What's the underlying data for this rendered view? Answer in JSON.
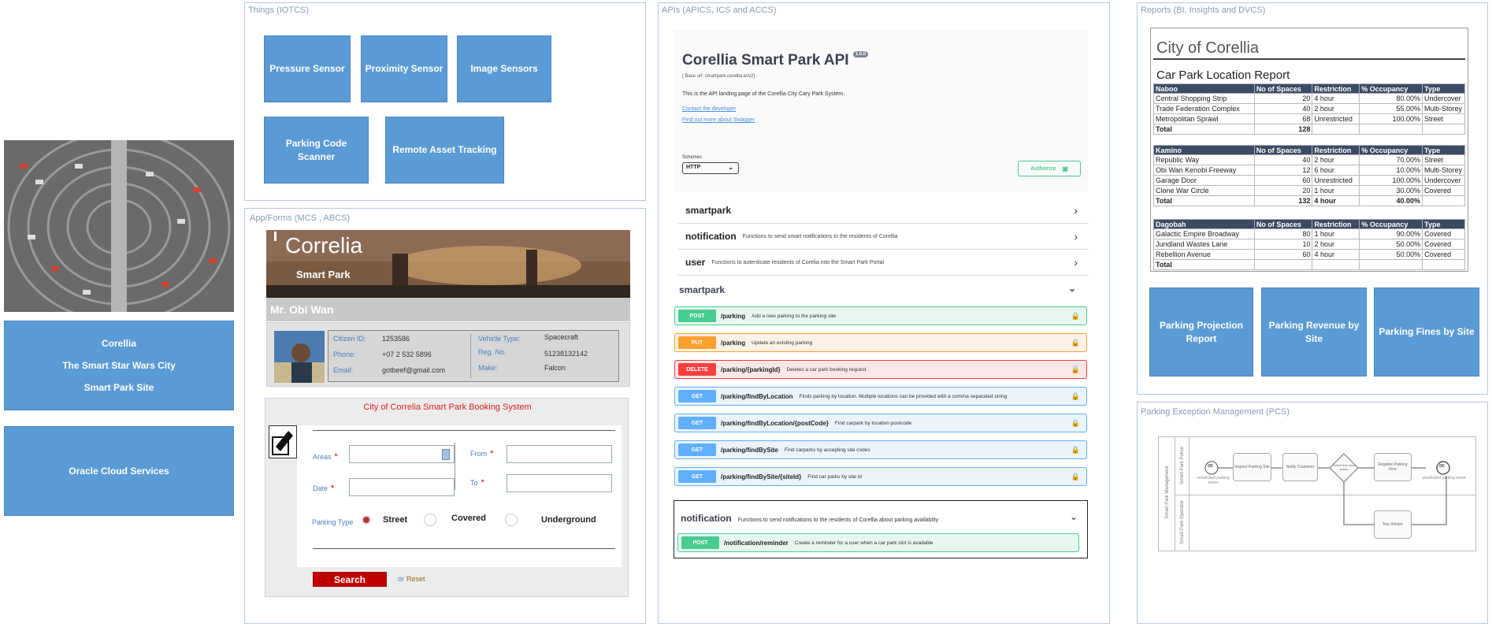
{
  "left": {
    "info_lines": [
      "Corellia",
      "The Smart Star Wars City",
      "Smart Park Site"
    ],
    "cloud_label": "Oracle Cloud Services"
  },
  "things": {
    "title": "Things (IOTCS)",
    "devices": [
      "Pressure Sensor",
      "Proximity Sensor",
      "Image Sensors",
      "Parking Code Scanner",
      "Remote Asset Tracking"
    ]
  },
  "app": {
    "title": "App/Forms (MCS , ABCS)",
    "banner_title": "Correlia",
    "banner_subtitle": "Smart Park",
    "user_name": "Mr. Obi Wan",
    "citizen": {
      "id_label": "Citizen ID:",
      "id_value": "1253586",
      "phone_label": "Phone:",
      "phone_value": "+07 2 532 5896",
      "email_label": "Email:",
      "email_value": "gotbeef@gmail.com",
      "vehicle_label": "Vehicle Type:",
      "vehicle_value": "Spacecraft",
      "reg_label": "Reg. No.",
      "reg_value": "51238132142",
      "make_label": "Make:",
      "make_value": "Falcon"
    },
    "booking": {
      "title": "City of Correlia Smart Park Booking System",
      "areas_label": "Areas",
      "date_label": "Date",
      "from_label": "From",
      "to_label": "To",
      "parking_type_label": "Parking Type",
      "options": [
        "Street",
        "Covered",
        "Underground"
      ],
      "search_label": "Search",
      "or_label": "or",
      "reset_label": "Reset"
    }
  },
  "apis": {
    "title": "APIs (APICS, ICS and ACCS)",
    "heading": "Corellia Smart Park API",
    "version_badge": "1.0.0",
    "base_url": "[ Base url: smartpark.corellia.io/v2]",
    "intro": "This is the API landing page of the Corellia City Cary Park System.",
    "link_contact": "Contact the developer",
    "link_swagger": "Find out more about Swagger",
    "schemes_label": "Schemes",
    "scheme_value": "HTTP",
    "authorize_label": "Authorize",
    "groups": [
      {
        "name": "smartpark",
        "desc": ""
      },
      {
        "name": "notification",
        "desc": "Functions to send smart notifications to the residents of Corellia"
      },
      {
        "name": "user",
        "desc": "Functions to autenticate residents of Corelia into the Smart Park Portal"
      }
    ],
    "section_name": "smartpark",
    "endpoints": [
      {
        "method": "POST",
        "path": "/parking",
        "desc": "Add a new parking to the parking site",
        "color": "#49cc90",
        "bg": "#e8f6f0"
      },
      {
        "method": "PUT",
        "path": "/parking",
        "desc": "Update an existing parking",
        "color": "#fca130",
        "bg": "#fbf1e6"
      },
      {
        "method": "DELETE",
        "path": "/parking/{parkingId}",
        "desc": "Deletes a car park booking request",
        "color": "#f93e3e",
        "bg": "#fae7e7"
      },
      {
        "method": "GET",
        "path": "/parking/findByLocation",
        "desc": "Finds parking by location. Multiple locations can be provided with a comma separated string",
        "color": "#61affe",
        "bg": "#ebf3fb"
      },
      {
        "method": "GET",
        "path": "/parking/findByLocation/{postCode}",
        "desc": "Find carpark by location postcode",
        "color": "#61affe",
        "bg": "#ebf3fb"
      },
      {
        "method": "GET",
        "path": "/parking/findBySite",
        "desc": "Find carparks by accepting site codes",
        "color": "#61affe",
        "bg": "#ebf3fb"
      },
      {
        "method": "GET",
        "path": "/parking/findBySite/{siteId}",
        "desc": "Find car parks by site id",
        "color": "#61affe",
        "bg": "#ebf3fb"
      }
    ],
    "notification_section": {
      "name": "notification",
      "desc": "Functions to send notifications to the residents of Corellia about parking availabilty",
      "endpoint": {
        "method": "POST",
        "path": "/notification/reminder",
        "desc": "Create a reminder for a user when a car park slot is available"
      }
    }
  },
  "reports": {
    "title": "Reports (BI, Insights and DVCS)",
    "city": "City of Corellia",
    "report_title": "Car Park Location Report",
    "headers": [
      "No of Spaces",
      "Restriction",
      "% Occupancy",
      "Type"
    ],
    "tables": [
      {
        "site": "Naboo",
        "rows": [
          [
            "Central Shopping Strip",
            "20",
            "4 hour",
            "80.00%",
            "Undercover"
          ],
          [
            "Trade Federation Complex",
            "40",
            "2 hour",
            "55.00%",
            "Multi-Storey"
          ],
          [
            "Metropolitan Sprawl",
            "68",
            "Unrestricted",
            "100.00%",
            "Street"
          ]
        ],
        "total": [
          "Total",
          "128",
          "",
          "",
          ""
        ]
      },
      {
        "site": "Kamino",
        "rows": [
          [
            "Republic Way",
            "40",
            "2 hour",
            "70.00%",
            "Street"
          ],
          [
            "Obi Wan Kenobi Freeway",
            "12",
            "6 hour",
            "10.00%",
            "Multi-Storey"
          ],
          [
            "Garage Door",
            "60",
            "Unrestricted",
            "100.00%",
            "Undercover"
          ],
          [
            "Clone War Circle",
            "20",
            "1 hour",
            "30.00%",
            "Covered"
          ]
        ],
        "total": [
          "Total",
          "132",
          "4 hour",
          "40.00%",
          ""
        ]
      },
      {
        "site": "Dagobah",
        "rows": [
          [
            "Galactic Empire Broadway",
            "80",
            "1 hour",
            "90.00%",
            "Covered"
          ],
          [
            "Jundland Wastes Lane",
            "10",
            "2 hour",
            "50.00%",
            "Covered"
          ],
          [
            "Rebellion Avenue",
            "60",
            "4 hour",
            "50.00%",
            "Covered"
          ]
        ],
        "total": [
          "Total",
          "",
          "",
          "",
          ""
        ]
      }
    ],
    "tiles": [
      "Parking Projection Report",
      "Parking Revenue by Site",
      "Parking Fines by Site"
    ]
  },
  "exceptions": {
    "title": "Parking Exception Management (PCS)",
    "pool_label": "Smart Park Management",
    "lanes": [
      "Smart Park Police",
      "Smart Park Operator"
    ],
    "nodes": [
      "unsolicited parking event",
      "Inspect Parking Site",
      "Notify Customer",
      "Determine next action",
      "Register Parking Fine",
      "unsolicited parking event",
      "Tow Vehicle"
    ]
  }
}
